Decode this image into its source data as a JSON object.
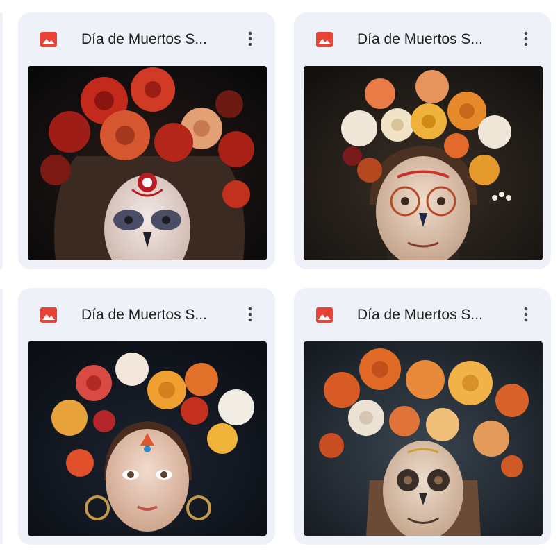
{
  "colors": {
    "card_bg": "#eef1f7",
    "image_icon": "#ea4335",
    "title_text": "#1f1f1f",
    "more_icon": "#444746"
  },
  "cards": [
    {
      "title": "Día de Muertos S...",
      "file_icon": "image-file-icon",
      "menu_icon": "more-vert-icon",
      "thumbnail": "girl-red-rose-crown-sugar-skull"
    },
    {
      "title": "Día de Muertos S...",
      "file_icon": "image-file-icon",
      "menu_icon": "more-vert-icon",
      "thumbnail": "boy-yellow-rose-crown-sugar-skull"
    },
    {
      "title": "Día de Muertos S...",
      "file_icon": "image-file-icon",
      "menu_icon": "more-vert-icon",
      "thumbnail": "girl-mixed-flower-crown-earrings"
    },
    {
      "title": "Día de Muertos S...",
      "file_icon": "image-file-icon",
      "menu_icon": "more-vert-icon",
      "thumbnail": "child-orange-flower-crown-sugar-skull"
    }
  ]
}
